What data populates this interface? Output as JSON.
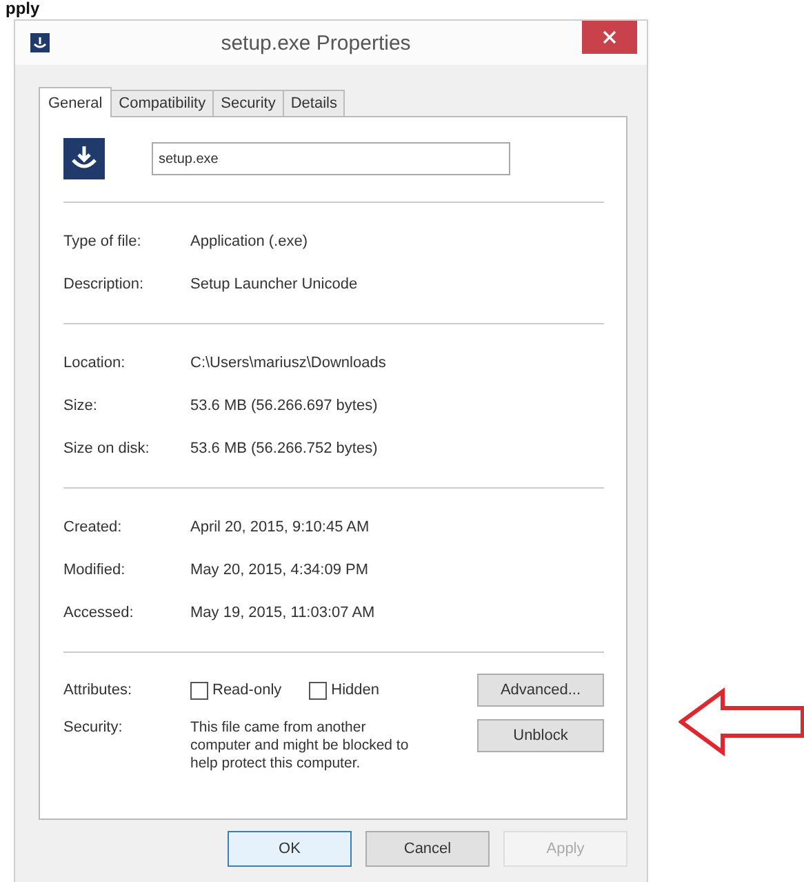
{
  "caption": "pply",
  "window": {
    "title": "setup.exe Properties"
  },
  "tabs": [
    {
      "label": "General",
      "selected": true
    },
    {
      "label": "Compatibility",
      "selected": false
    },
    {
      "label": "Security",
      "selected": false
    },
    {
      "label": "Details",
      "selected": false
    }
  ],
  "file_name": "setup.exe",
  "groups": [
    [
      {
        "label": "Type of file:",
        "value": "Application (.exe)"
      },
      {
        "label": "Description:",
        "value": "Setup Launcher Unicode"
      }
    ],
    [
      {
        "label": "Location:",
        "value": "C:\\Users\\mariusz\\Downloads"
      },
      {
        "label": "Size:",
        "value": "53.6 MB (56.266.697 bytes)"
      },
      {
        "label": "Size on disk:",
        "value": "53.6 MB (56.266.752 bytes)"
      }
    ],
    [
      {
        "label": "Created:",
        "value": "April 20, 2015, 9:10:45 AM"
      },
      {
        "label": "Modified:",
        "value": "May 20, 2015, 4:34:09 PM"
      },
      {
        "label": "Accessed:",
        "value": "May 19, 2015, 11:03:07 AM"
      }
    ]
  ],
  "attributes": {
    "label": "Attributes:",
    "checkboxes": [
      {
        "label": "Read-only",
        "checked": false
      },
      {
        "label": "Hidden",
        "checked": false
      }
    ],
    "button": "Advanced..."
  },
  "security": {
    "label": "Security:",
    "text": "This file came from another computer and might be blocked to help protect this computer.",
    "button": "Unblock"
  },
  "buttons": [
    {
      "label": "OK",
      "disabled": false
    },
    {
      "label": "Cancel",
      "disabled": false
    },
    {
      "label": "Apply",
      "disabled": true
    }
  ]
}
